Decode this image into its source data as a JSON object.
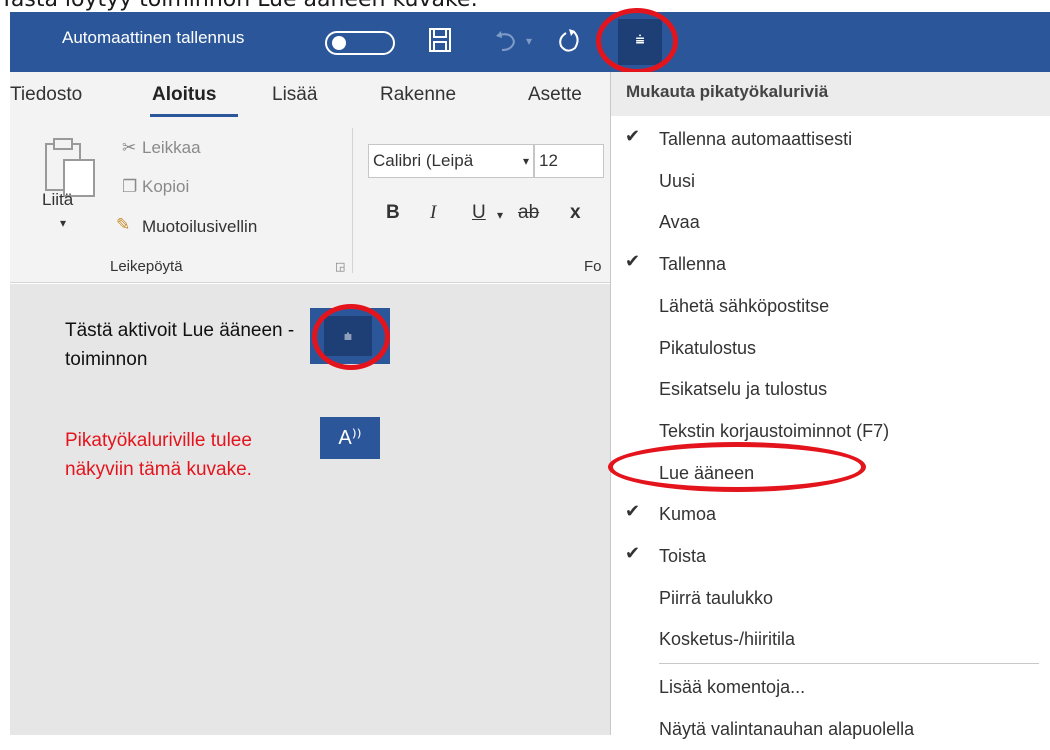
{
  "caption": "Tästä löytyy toiminnon Lue ääneen kuvake:",
  "title_bar": {
    "autosave_label": "Automaattinen tallennus",
    "customize_glyph": "⩧"
  },
  "tabs": [
    "Tiedosto",
    "Aloitus",
    "Lisää",
    "Rakenne",
    "Asette"
  ],
  "ribbon": {
    "paste_label": "Liitä",
    "cut_label": "Leikkaa",
    "copy_label": "Kopioi",
    "format_painter_label": "Muotoilusivellin",
    "clipboard_group": "Leikepöytä",
    "font_name": "Calibri (Leipä",
    "font_size": "12",
    "font_group": "Fo",
    "bold": "B",
    "italic": "I",
    "underline": "U",
    "strike": "ab",
    "subscript": "x"
  },
  "document": {
    "instruction_black": "Tästä aktivoit Lue ääneen -toiminnon",
    "instruction_red": "Pikatyökaluriville tulee näkyviin tämä kuvake.",
    "readaloud_icon_text": "A⁾⁾"
  },
  "menu": {
    "header": "Mukauta pikatyökaluriviä",
    "items": [
      {
        "label": "Tallenna automaattisesti",
        "checked": true
      },
      {
        "label": "Uusi",
        "checked": false
      },
      {
        "label": "Avaa",
        "checked": false
      },
      {
        "label": "Tallenna",
        "checked": true
      },
      {
        "label": "Lähetä sähköpostitse",
        "checked": false
      },
      {
        "label": "Pikatulostus",
        "checked": false
      },
      {
        "label": "Esikatselu ja tulostus",
        "checked": false
      },
      {
        "label": "Tekstin korjaustoiminnot (F7)",
        "checked": false
      },
      {
        "label": "Lue ääneen",
        "checked": false
      },
      {
        "label": "Kumoa",
        "checked": true
      },
      {
        "label": "Toista",
        "checked": true
      },
      {
        "label": "Piirrä taulukko",
        "checked": false
      },
      {
        "label": "Kosketus-/hiiritila",
        "checked": false
      },
      {
        "label": "Lisää komentoja...",
        "checked": false
      },
      {
        "label": "Näytä valintanauhan alapuolella",
        "checked": false
      }
    ]
  },
  "colors": {
    "title_bar": "#2b579a",
    "highlight_ring": "#e4141d"
  }
}
